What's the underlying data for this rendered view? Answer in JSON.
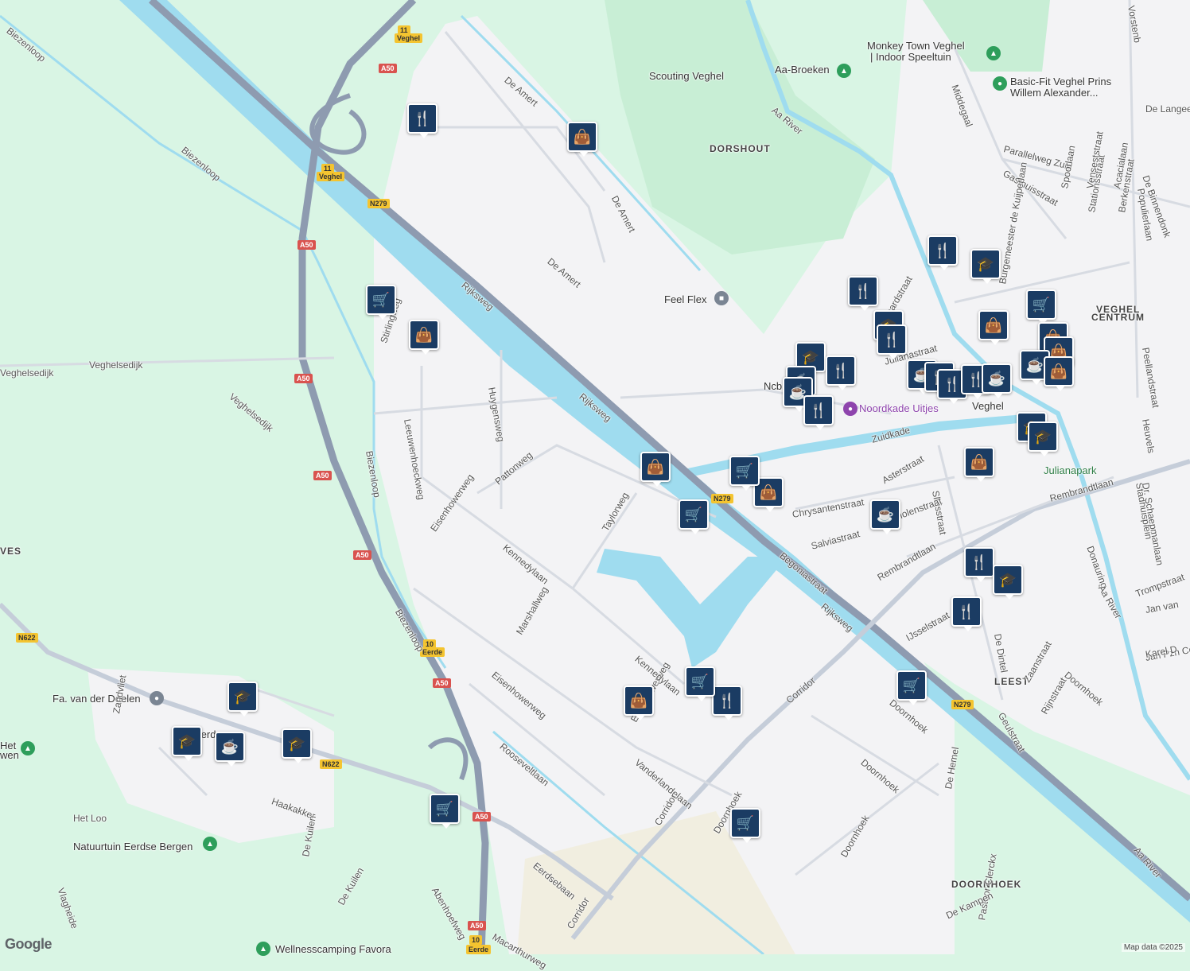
{
  "map": {
    "attribution": "Map data ©2025",
    "logo": "Google",
    "colors": {
      "land": "#d9f5e4",
      "urban": "#f3f3f5",
      "water": "#9fdcef",
      "highway": "#8e9bb0",
      "road": "#ffffff",
      "marker": "#1b3c63"
    },
    "areas": [
      {
        "id": "dorshout",
        "text": "DORSHOUT"
      },
      {
        "id": "veghel-centrum-1",
        "text": "VEGHEL"
      },
      {
        "id": "veghel-centrum-2",
        "text": "CENTRUM"
      },
      {
        "id": "leest",
        "text": "LEEST"
      },
      {
        "id": "doornhoek",
        "text": "DOORNHOEK"
      },
      {
        "id": "ves",
        "text": "VES"
      }
    ],
    "places": [
      {
        "id": "veghel",
        "text": "Veghel"
      },
      {
        "id": "monkey1",
        "text": "Monkey Town Veghel"
      },
      {
        "id": "monkey2",
        "text": "| Indoor Speeltuin"
      },
      {
        "id": "aa-broeken",
        "text": "Aa-Broeken"
      },
      {
        "id": "scouting",
        "text": "Scouting Veghel"
      },
      {
        "id": "basicfit1",
        "text": "Basic-Fit Veghel Prins"
      },
      {
        "id": "basicfit2",
        "text": "Willem Alexander..."
      },
      {
        "id": "feelflex",
        "text": "Feel Flex"
      },
      {
        "id": "noordkade",
        "text": "Noordkade Uitjes"
      },
      {
        "id": "ncb",
        "text": "Ncb"
      },
      {
        "id": "julianapark",
        "text": "Julianapark"
      },
      {
        "id": "doelen",
        "text": "Fa. van der Doelen"
      },
      {
        "id": "natuurtuin",
        "text": "Natuurtuin Eerdse Bergen"
      },
      {
        "id": "wellness",
        "text": "Wellnesscamping Favora"
      },
      {
        "id": "hetloo",
        "text": "Het Loo"
      },
      {
        "id": "het",
        "text": "Het"
      },
      {
        "id": "wen",
        "text": "wen"
      },
      {
        "id": "eerde",
        "text": "Eerde"
      }
    ],
    "streets": [
      "Rijksweg",
      "Rijksweg",
      "Rijksweg",
      "De Amert",
      "De Amert",
      "De Amert",
      "Huygensweg",
      "Leeuwenhoeckweg",
      "Stirlingweg",
      "Pattonweg",
      "Eisenhowerweg",
      "Eisenhowerweg",
      "Eisenhowerweg",
      "Kennedylaan",
      "Kennedylaan",
      "Taylorweg",
      "Marshallweg",
      "Rooseveltlaan",
      "Vanderlandelaan",
      "Corridor",
      "Corridor",
      "Corridor",
      "Doornhoek",
      "Doornhoek",
      "Doornhoek",
      "Doornhoek",
      "Doornhoek",
      "Eerdsebaan",
      "Macarthurweg",
      "Abenhoefweg",
      "Zuidkade",
      "Sluisstraat",
      "Rembrandtlaan",
      "Rembrandtlaan",
      "Chrysantenstraat",
      "Asterstraat",
      "Begoniastraat",
      "Salviastraat",
      "Violenstraat",
      "IJsselstraat",
      "Geulstraat",
      "Zaanstraat",
      "Rijnstraat",
      "De Dintel",
      "Donauring",
      "Trompstraat",
      "Middegaal",
      "Parallelweg Zuid",
      "Gasthuisstraat",
      "Spoorlaan",
      "Stationsstraat",
      "Burgemeester de Kuijperlaan",
      "Populierlaan",
      "Acacialaan",
      "Berkenstraat",
      "Venseststraat",
      "De Langee",
      "Peellandstraat",
      "Stadhuisplein",
      "Dr. Schaepmanlaan",
      "Jan Pzn Coen",
      "Karel D",
      "Jan van",
      "Heuvels",
      "Veghelsedijk",
      "Veghelsedijk",
      "Veghelsedijk",
      "Biezenloop",
      "Biezenloop",
      "Biezenloop",
      "Biezenloop",
      "Aa River",
      "Aa River",
      "Aa River",
      "Haakakker",
      "De Kuilen",
      "De Kuilen",
      "Zandvliet",
      "Vlagheide",
      "De Hemel",
      "Pastoor Clerckx",
      "De Kampen",
      "Vorstenb",
      "De Binnendonk",
      "Julianastraat",
      "Bernhardstraat"
    ],
    "shields": [
      {
        "id": "s1",
        "text": "11",
        "type": "n"
      },
      {
        "id": "s2",
        "text": "Veghel",
        "type": "n"
      },
      {
        "id": "s3",
        "text": "A50",
        "type": "a"
      },
      {
        "id": "s4",
        "text": "11",
        "type": "n"
      },
      {
        "id": "s5",
        "text": "Veghel",
        "type": "n"
      },
      {
        "id": "s6",
        "text": "N279",
        "type": "n"
      },
      {
        "id": "s7",
        "text": "A50",
        "type": "a"
      },
      {
        "id": "s8",
        "text": "A50",
        "type": "a"
      },
      {
        "id": "s9",
        "text": "A50",
        "type": "a"
      },
      {
        "id": "s10",
        "text": "A50",
        "type": "a"
      },
      {
        "id": "s11",
        "text": "N622",
        "type": "n"
      },
      {
        "id": "s12",
        "text": "10",
        "type": "n"
      },
      {
        "id": "s13",
        "text": "Eerde",
        "type": "n"
      },
      {
        "id": "s14",
        "text": "A50",
        "type": "a"
      },
      {
        "id": "s15",
        "text": "N279",
        "type": "n"
      },
      {
        "id": "s16",
        "text": "N622",
        "type": "n"
      },
      {
        "id": "s17",
        "text": "A50",
        "type": "a"
      },
      {
        "id": "s18",
        "text": "N279",
        "type": "n"
      },
      {
        "id": "s19",
        "text": "A50",
        "type": "a"
      },
      {
        "id": "s20",
        "text": "10",
        "type": "n"
      },
      {
        "id": "s21",
        "text": "Eerde",
        "type": "n"
      }
    ],
    "markers": [
      {
        "icon": "restaurant-icon",
        "glyph": "🍴"
      },
      {
        "icon": "shopping-bag-icon",
        "glyph": "👜"
      },
      {
        "icon": "grocery-cart-icon",
        "glyph": "🛒"
      },
      {
        "icon": "shopping-bag-icon",
        "glyph": "👜"
      },
      {
        "icon": "shopping-bag-icon",
        "glyph": "👜"
      },
      {
        "icon": "grocery-cart-icon",
        "glyph": "🛒"
      },
      {
        "icon": "shopping-bag-icon",
        "glyph": "👜"
      },
      {
        "icon": "grocery-cart-icon",
        "glyph": "🛒"
      },
      {
        "icon": "grocery-cart-icon",
        "glyph": "🛒"
      },
      {
        "icon": "restaurant-icon",
        "glyph": "🍴"
      },
      {
        "icon": "shopping-bag-icon",
        "glyph": "👜"
      },
      {
        "icon": "grocery-cart-icon",
        "glyph": "🛒"
      },
      {
        "icon": "grocery-cart-icon",
        "glyph": "🛒"
      },
      {
        "icon": "school-icon",
        "glyph": "🎓"
      },
      {
        "icon": "school-icon",
        "glyph": "🎓"
      },
      {
        "icon": "coffee-icon",
        "glyph": "☕"
      },
      {
        "icon": "school-icon",
        "glyph": "🎓"
      },
      {
        "icon": "restaurant-icon",
        "glyph": "🍴"
      },
      {
        "icon": "school-icon",
        "glyph": "🎓"
      },
      {
        "icon": "restaurant-icon",
        "glyph": "🍴"
      },
      {
        "icon": "school-icon",
        "glyph": "🎓"
      },
      {
        "icon": "restaurant-icon",
        "glyph": "🍴"
      },
      {
        "icon": "school-icon",
        "glyph": "🎓"
      },
      {
        "icon": "restaurant-icon",
        "glyph": "🍴"
      },
      {
        "icon": "coffee-icon",
        "glyph": "☕"
      },
      {
        "icon": "coffee-icon",
        "glyph": "☕"
      },
      {
        "icon": "restaurant-icon",
        "glyph": "🍴"
      },
      {
        "icon": "coffee-icon",
        "glyph": "☕"
      },
      {
        "icon": "restaurant-icon",
        "glyph": "🍴"
      },
      {
        "icon": "restaurant-icon",
        "glyph": "🍴"
      },
      {
        "icon": "restaurant-icon",
        "glyph": "🍴"
      },
      {
        "icon": "coffee-icon",
        "glyph": "☕"
      },
      {
        "icon": "shopping-bag-icon",
        "glyph": "👜"
      },
      {
        "icon": "grocery-cart-icon",
        "glyph": "🛒"
      },
      {
        "icon": "shopping-bag-icon",
        "glyph": "👜"
      },
      {
        "icon": "shopping-bag-icon",
        "glyph": "👜"
      },
      {
        "icon": "coffee-icon",
        "glyph": "☕"
      },
      {
        "icon": "shopping-bag-icon",
        "glyph": "👜"
      },
      {
        "icon": "school-icon",
        "glyph": "🎓"
      },
      {
        "icon": "school-icon",
        "glyph": "🎓"
      },
      {
        "icon": "shopping-bag-icon",
        "glyph": "👜"
      },
      {
        "icon": "coffee-icon",
        "glyph": "☕"
      },
      {
        "icon": "restaurant-icon",
        "glyph": "🍴"
      },
      {
        "icon": "school-icon",
        "glyph": "🎓"
      },
      {
        "icon": "restaurant-icon",
        "glyph": "🍴"
      },
      {
        "icon": "grocery-cart-icon",
        "glyph": "🛒"
      }
    ]
  }
}
